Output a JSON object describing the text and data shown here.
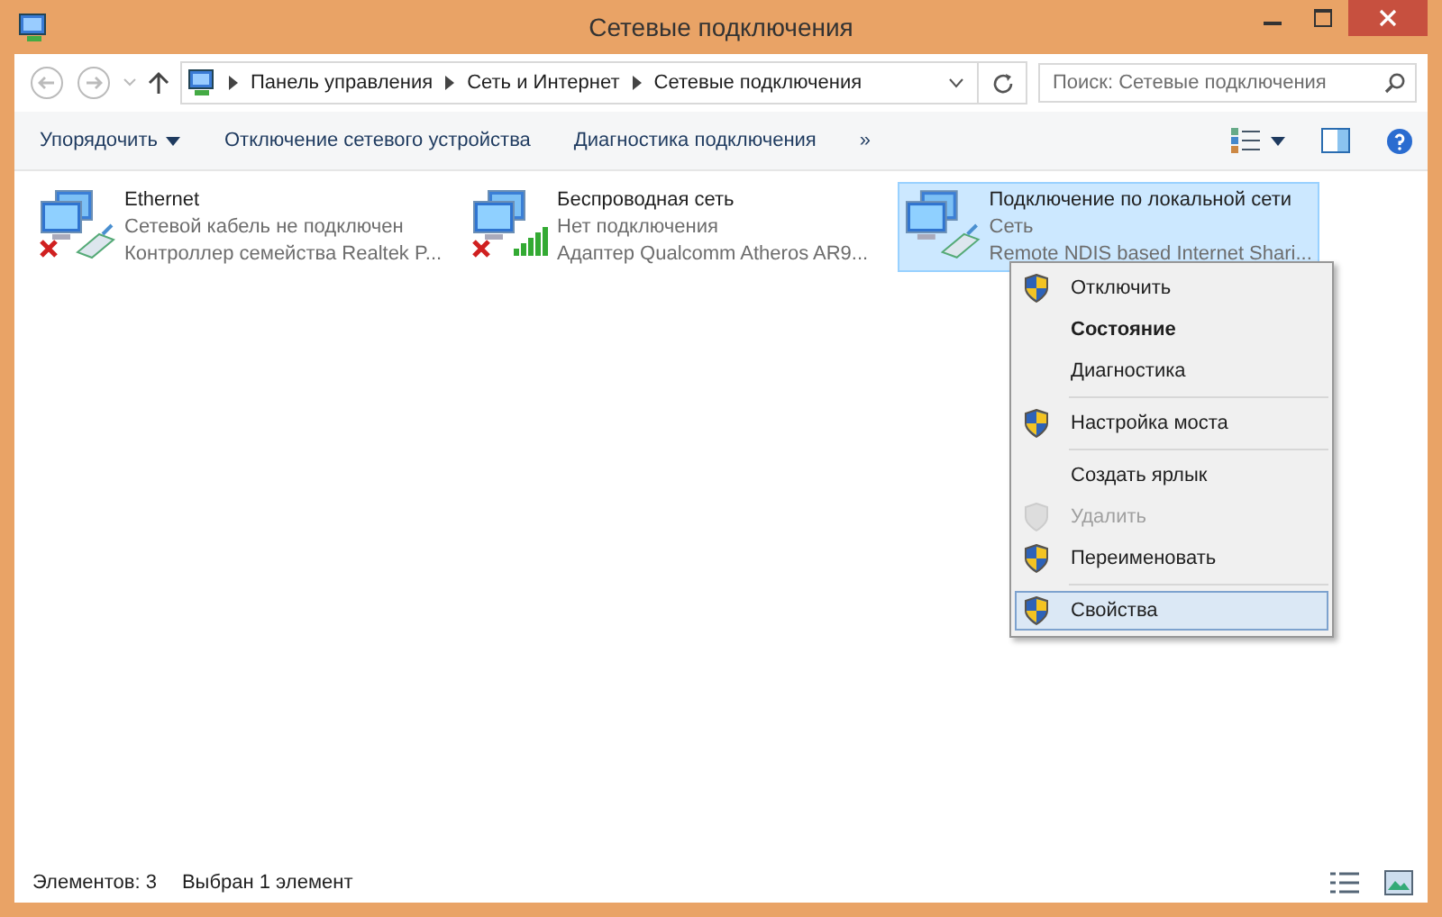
{
  "window": {
    "title": "Сетевые подключения"
  },
  "address": {
    "crumbs": [
      "Панель управления",
      "Сеть и Интернет",
      "Сетевые подключения"
    ]
  },
  "search": {
    "placeholder": "Поиск: Сетевые подключения"
  },
  "toolbar": [
    {
      "label": "Упорядочить",
      "dropdown": true
    },
    {
      "label": "Отключение сетевого устройства",
      "dropdown": false
    },
    {
      "label": "Диагностика подключения",
      "dropdown": false
    },
    {
      "label": "»",
      "dropdown": false
    }
  ],
  "connections": [
    {
      "name": "Ethernet",
      "status": "Сетевой кабель не подключен",
      "adapter": "Контроллер семейства Realtek P...",
      "kind": "cable",
      "error": true,
      "selected": false
    },
    {
      "name": "Беспроводная сеть",
      "status": "Нет подключения",
      "adapter": "Адаптер Qualcomm Atheros AR9...",
      "kind": "wireless",
      "error": true,
      "selected": false
    },
    {
      "name": "Подключение по локальной сети",
      "status": "Сеть",
      "adapter": "Remote NDIS based Internet Shari...",
      "kind": "cable",
      "error": false,
      "selected": true
    }
  ],
  "context_menu": [
    {
      "kind": "item",
      "label": "Отключить",
      "shield": true,
      "default": false,
      "disabled": false,
      "selected": false
    },
    {
      "kind": "item",
      "label": "Состояние",
      "shield": false,
      "default": true,
      "disabled": false,
      "selected": false
    },
    {
      "kind": "item",
      "label": "Диагностика",
      "shield": false,
      "default": false,
      "disabled": false,
      "selected": false
    },
    {
      "kind": "separator"
    },
    {
      "kind": "item",
      "label": "Настройка моста",
      "shield": true,
      "default": false,
      "disabled": false,
      "selected": false
    },
    {
      "kind": "separator"
    },
    {
      "kind": "item",
      "label": "Создать ярлык",
      "shield": false,
      "default": false,
      "disabled": false,
      "selected": false
    },
    {
      "kind": "item",
      "label": "Удалить",
      "shield": true,
      "default": false,
      "disabled": true,
      "selected": false
    },
    {
      "kind": "item",
      "label": "Переименовать",
      "shield": true,
      "default": false,
      "disabled": false,
      "selected": false
    },
    {
      "kind": "separator"
    },
    {
      "kind": "item",
      "label": "Свойства",
      "shield": true,
      "default": false,
      "disabled": false,
      "selected": true
    }
  ],
  "status_bar": {
    "count": "Элементов: 3",
    "selection": "Выбран 1 элемент"
  }
}
